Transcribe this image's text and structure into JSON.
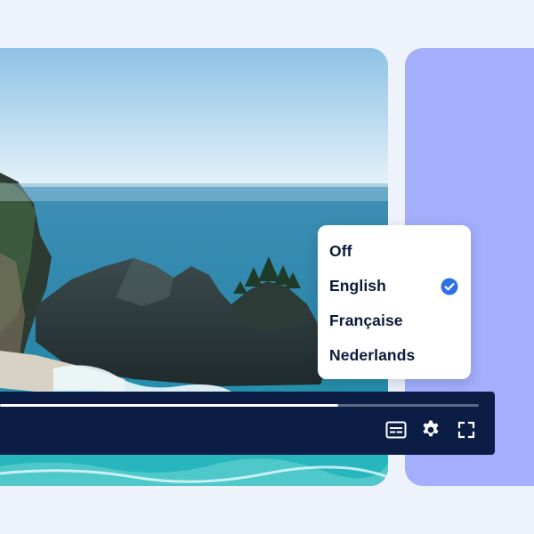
{
  "captions_menu": {
    "options": [
      {
        "label": "Off",
        "selected": false
      },
      {
        "label": "English",
        "selected": true
      },
      {
        "label": "Française",
        "selected": false
      },
      {
        "label": "Nederlands",
        "selected": false
      }
    ],
    "check_color": "#2f6fe4"
  },
  "player": {
    "progress": 0.706,
    "controls": [
      "captions-icon",
      "settings-gear-icon",
      "fullscreen-icon"
    ]
  },
  "colors": {
    "page_background": "#eef2fb",
    "side_panel": "#a3aefc",
    "control_bar": "#0b1d45"
  }
}
